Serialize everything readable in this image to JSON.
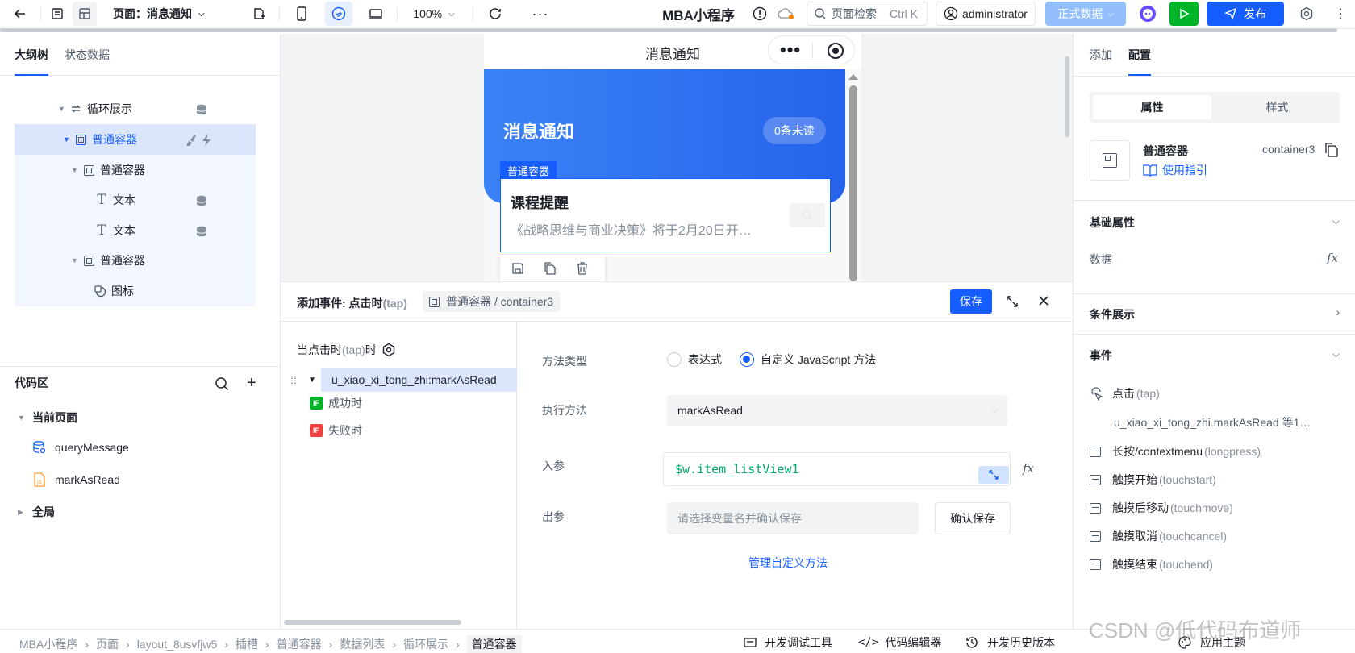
{
  "topbar": {
    "page_label": "页面：消息通知",
    "zoom": "100%",
    "app_name": "MBA小程序",
    "search_placeholder": "页面检索",
    "search_shortcut": "Ctrl K",
    "user": "administrator",
    "env": "正式数据",
    "publish": "发布"
  },
  "left": {
    "tab_outline": "大纲树",
    "tab_state": "状态数据",
    "tree": [
      {
        "label": "循环展示"
      },
      {
        "label": "普通容器"
      },
      {
        "label": "普通容器"
      },
      {
        "label": "文本"
      },
      {
        "label": "文本"
      },
      {
        "label": "普通容器"
      },
      {
        "label": "图标"
      }
    ],
    "code_title": "代码区",
    "current_page": "当前页面",
    "methods": [
      "queryMessage",
      "markAsRead"
    ],
    "global": "全局"
  },
  "phone": {
    "nav_title": "消息通知",
    "banner_title": "消息通知",
    "unread": "0条未读",
    "container_tag": "普通容器",
    "card_title": "课程提醒",
    "card_desc": "《战略思维与商业决策》将于2月20日开…"
  },
  "drawer": {
    "title": "添加事件: 点击时",
    "title_hint": "(tap)",
    "target": "普通容器 / container3",
    "save": "保存",
    "trigger": "当点击时",
    "trigger_hint": "(tap)",
    "trigger_tail": "时",
    "action": "u_xiao_xi_tong_zhi:markAsRead",
    "success": "成功时",
    "fail": "失败时",
    "if_tag": "IF",
    "method_type_label": "方法类型",
    "opt_expr": "表达式",
    "opt_js": "自定义 JavaScript 方法",
    "exec_label": "执行方法",
    "exec_value": "markAsRead",
    "param_label": "入参",
    "param_value": "$w.item_listView1",
    "out_label": "出参",
    "out_placeholder": "请选择变量名并确认保存",
    "confirm": "确认保存",
    "manage": "管理自定义方法"
  },
  "right": {
    "tab_add": "添加",
    "tab_config": "配置",
    "seg_props": "属性",
    "seg_style": "样式",
    "comp_name": "普通容器",
    "comp_id": "container3",
    "guide": "使用指引",
    "basic": "基础属性",
    "data_label": "数据",
    "cond": "条件展示",
    "events": "事件",
    "tap": "点击",
    "tap_hint": "(tap)",
    "tap_action": "u_xiao_xi_tong_zhi.markAsRead 等1…",
    "longpress": "长按/contextmenu",
    "longpress_hint": "(longpress)",
    "touchstart": "触摸开始",
    "touchstart_hint": "(touchstart)",
    "touchmove": "触摸后移动",
    "touchmove_hint": "(touchmove)",
    "touchcancel": "触摸取消",
    "touchcancel_hint": "(touchcancel)",
    "touchend": "触摸结束",
    "touchend_hint": "(touchend)"
  },
  "statusbar": {
    "crumbs": [
      "MBA小程序",
      "页面",
      "layout_8usvfjw5",
      "插槽",
      "普通容器",
      "数据列表",
      "循环展示",
      "普通容器"
    ],
    "devtools": "开发调试工具",
    "code_editor": "代码编辑器",
    "history": "开发历史版本",
    "theme": "应用主题",
    "watermark": "CSDN @低代码布道师"
  },
  "colors": {
    "primary": "#165dff",
    "green": "#00b42a",
    "red": "#f53f3f",
    "banner": "#3b6ff5"
  }
}
